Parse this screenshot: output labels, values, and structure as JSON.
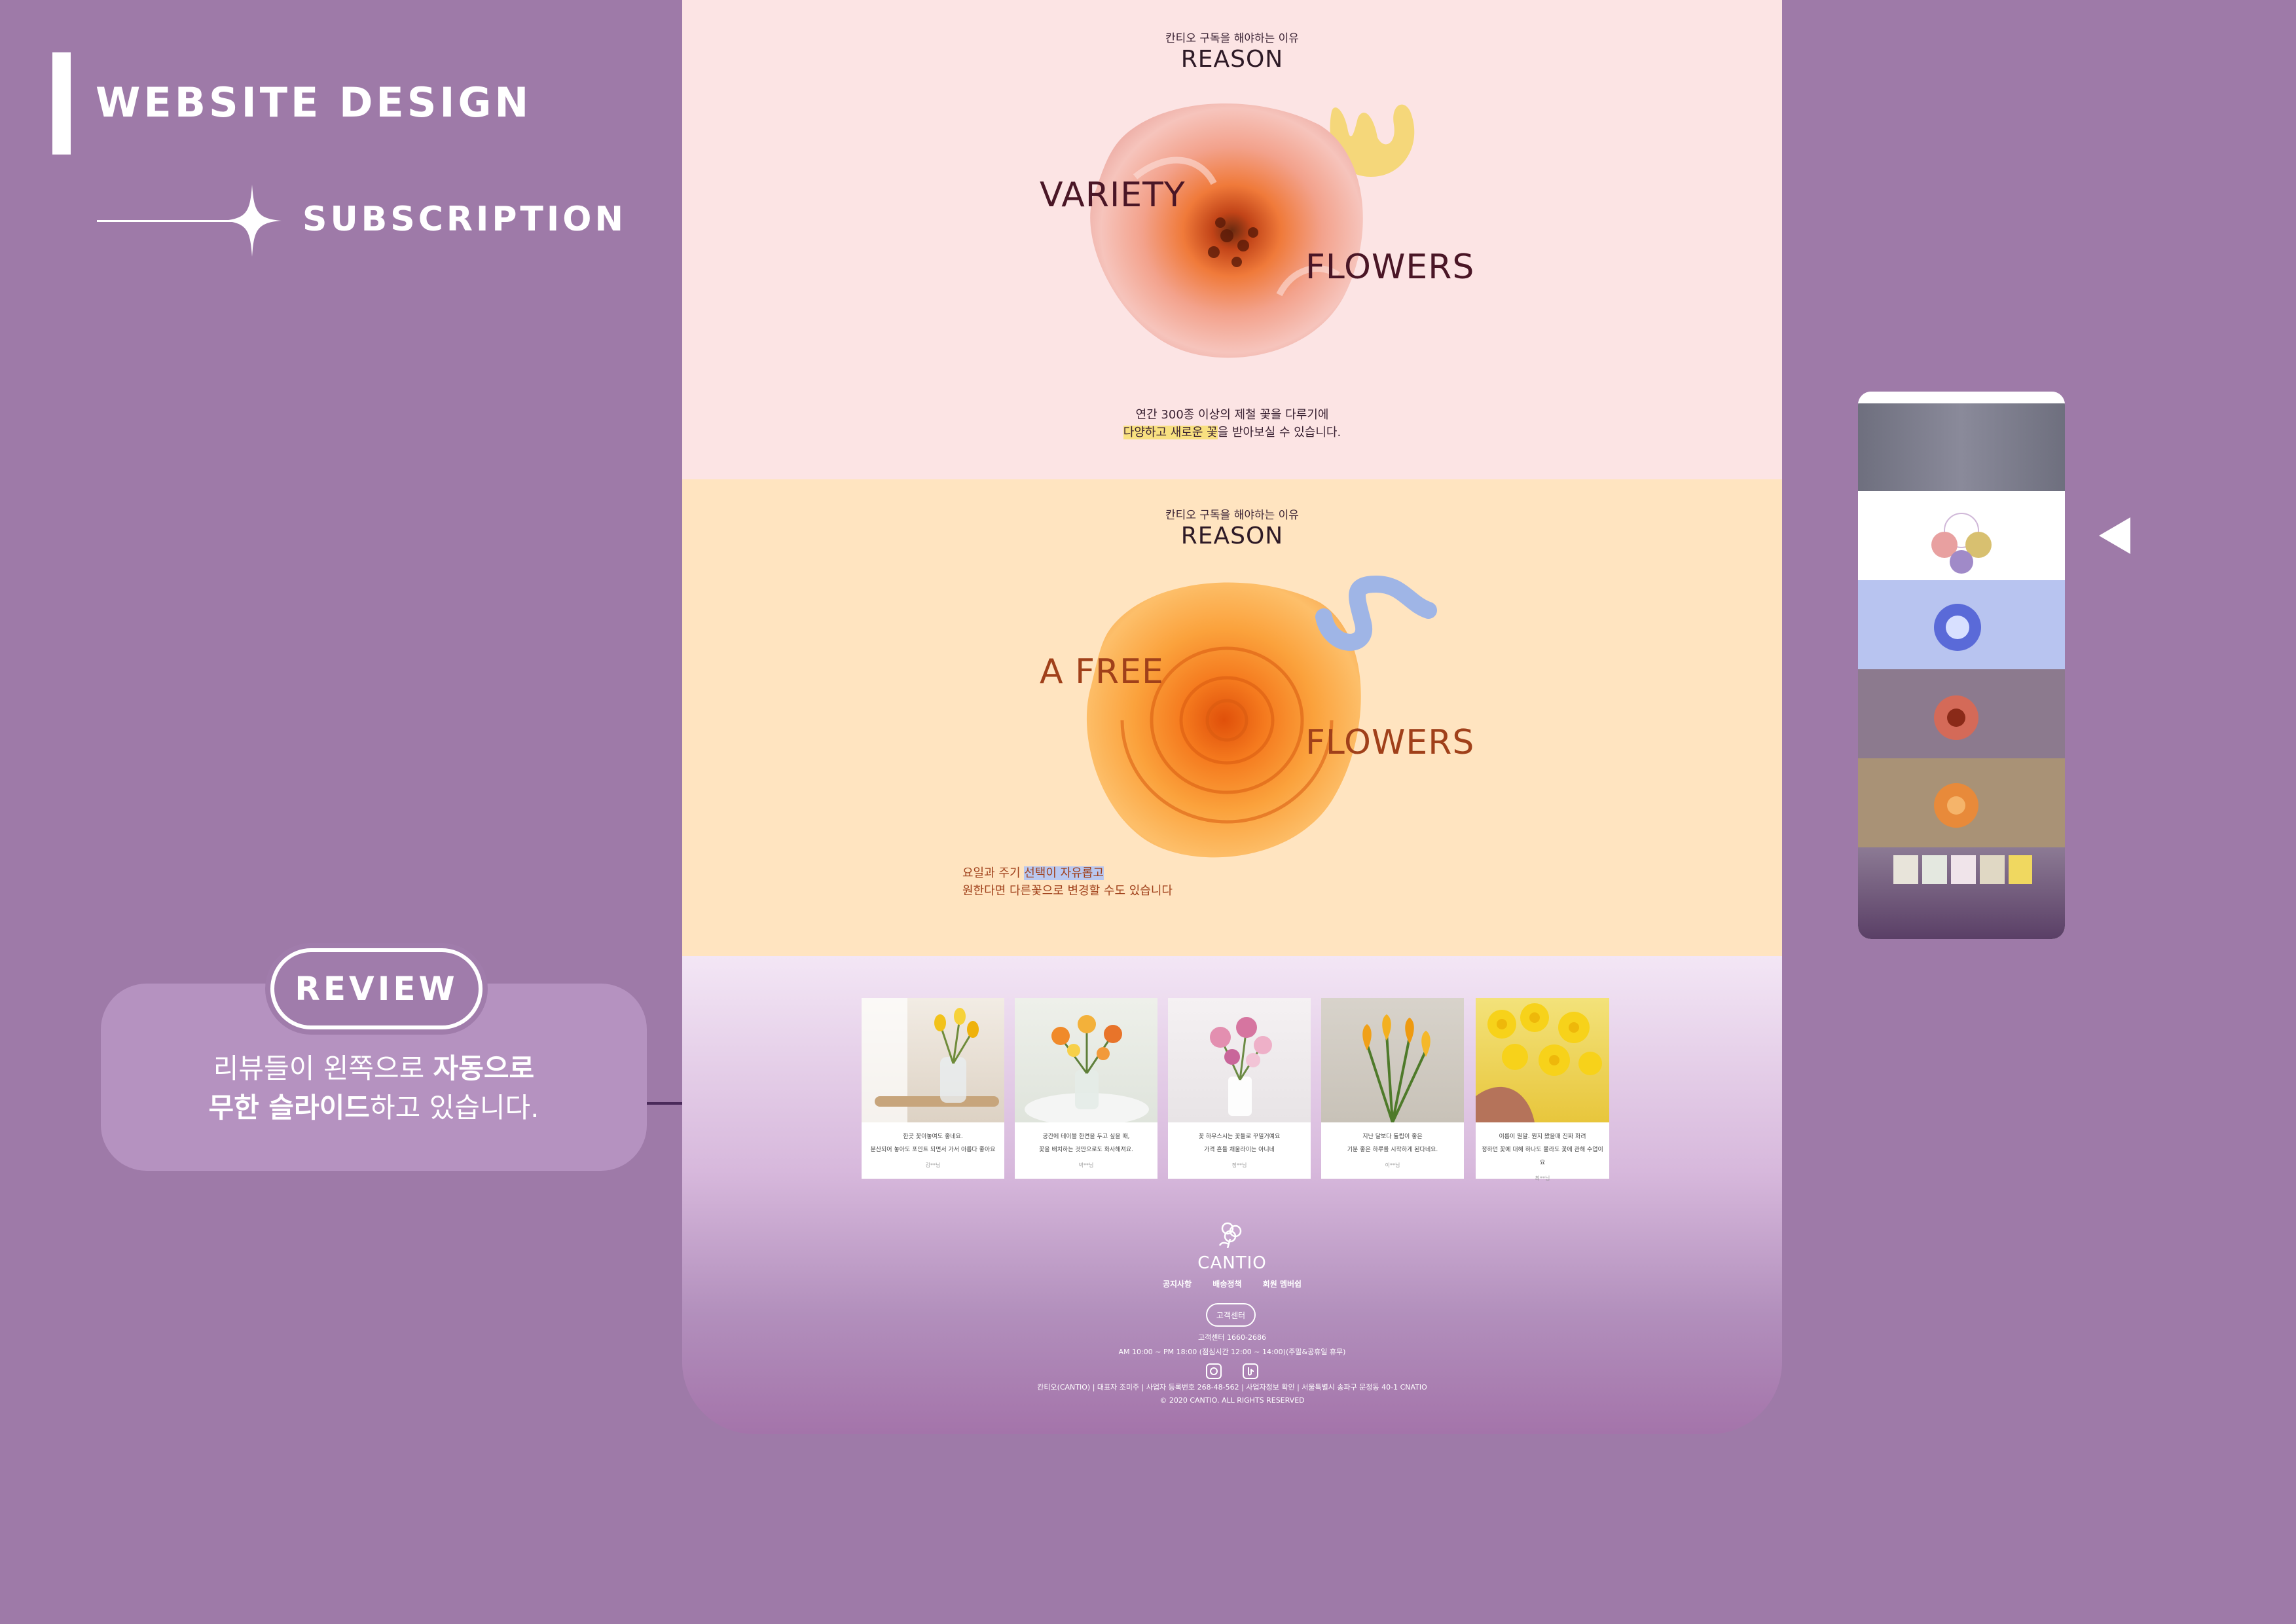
{
  "header": {
    "title": "WEBSITE DESIGN",
    "subtitle": "SUBSCRIPTION"
  },
  "callout": {
    "badge": "REVIEW",
    "line1_normal": "리뷰들이 왼쪽으로 ",
    "line1_bold": "자동으로",
    "line2_bold": "무한 슬라이드",
    "line2_normal": "하고 있습니다."
  },
  "section_variety": {
    "kicker": "칸티오 구독을 해야하는 이유",
    "heading": "REASON",
    "word_left": "VARIETY",
    "word_right": "FLOWERS",
    "desc_line1": "연간 300종 이상의 제철 꽃을 다루기에",
    "desc_line2_highlight": "다양하고 새로운 꽃",
    "desc_line2_rest": "을 받아보실 수 있습니다.",
    "colors": {
      "bg": "#fce4e4",
      "accent": "#f5d77a"
    }
  },
  "section_free": {
    "kicker": "칸티오 구독을 해야하는 이유",
    "heading": "REASON",
    "word_left": "A FREE",
    "word_right": "FLOWERS",
    "desc_line1_start": "요일과 주기 ",
    "desc_line1_highlight": "선택이 자유롭고",
    "desc_line2": "원한다면 다른꽃으로 변경할 수도 있습니다",
    "colors": {
      "bg": "#ffe4c0",
      "accent": "#9fb5e6"
    }
  },
  "reviews": [
    {
      "line1": "한곳 꽃이놓여도 좋네요.",
      "line2": "분산되어 놓아도 포인트 되면서 가서 아름다 좋아요",
      "author": "김**님"
    },
    {
      "line1": "공간에 테이블 한켠을 두고 싶을 때,",
      "line2": "꽃을 배치하는 것만으로도 화사해져요.",
      "author": "박**님"
    },
    {
      "line1": "꽃 하우스시는 꽃들로 꾸밀거예요",
      "line2": "가격 흔들 채울라이는 아니네",
      "author": "정**님"
    },
    {
      "line1": "지난 달보다 튤립이 좋은",
      "line2": "기분 좋은 하루를 시작하게 된다네요.",
      "author": "이**님"
    },
    {
      "line1": "이름이 뭔말. 뭔지 봤을때 진짜 화려",
      "line2": "정하던 꽃에 대해 하나도 몰라도 꽃에 관해 수업이요",
      "author": "최**님"
    }
  ],
  "footer": {
    "logo": "CANTIO",
    "links": [
      "공지사항",
      "배송정책",
      "회원 멤버쉽"
    ],
    "cs_button": "고객센터",
    "cs_phone": "고객센터 1660-2686",
    "hours": "AM 10:00 ~ PM 18:00 (점심시간 12:00 ~ 14:00)(주말&공휴일 휴무)",
    "company": "칸티오(CANTIO)  |  대표자 조미주  |  사업자 등록번호 268-48-562  |  사업자정보 확인  |  서울특별시 송파구 문정동 40-1 CNATIO",
    "copyright": "© 2020 CANTIO. ALL RIGHTS RESERVED"
  },
  "icons": {
    "star": "sparkle-star-icon",
    "arrow": "triangle-left-icon",
    "instagram": "instagram-icon",
    "social2": "social-icon"
  }
}
